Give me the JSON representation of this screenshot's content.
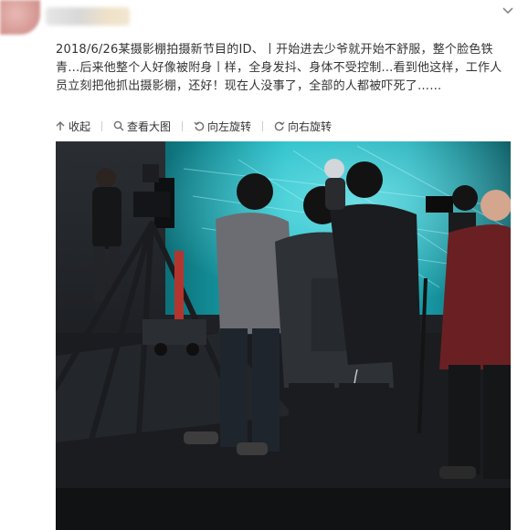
{
  "post": {
    "text": "2018/6/26某摄影棚拍摄新节目的ID、丨开始进去少爷就开始不舒服，整个脸色铁青…后来他整个人好像被附身丨样，全身发抖、身体不受控制…看到他这样，工作人员立刻把他抓出摄影棚，还好！现在人没事了，全部的人都被吓死了……"
  },
  "toolbar": {
    "collapse_label": "收起",
    "view_large_label": "查看大图",
    "rotate_left_label": "向左旋转",
    "rotate_right_label": "向右旋转"
  },
  "icons": {
    "collapse": "collapse-up-icon",
    "view_large": "magnify-icon",
    "rotate_left": "rotate-left-icon",
    "rotate_right": "rotate-right-icon",
    "menu": "chevron-down-icon"
  },
  "colors": {
    "text": "#333333",
    "icon": "#808080",
    "led_screen": "#1fb8c4"
  }
}
